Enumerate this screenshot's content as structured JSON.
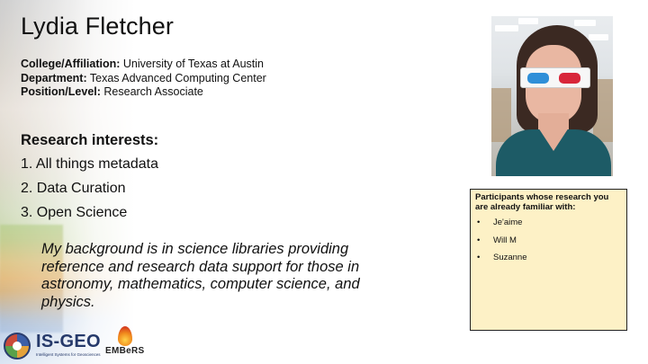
{
  "slide": {
    "name": "Lydia Fletcher",
    "affiliation": {
      "label": "College/Affiliation:",
      "value": "University of Texas at Austin"
    },
    "department": {
      "label": "Department:",
      "value": "Texas Advanced Computing Center"
    },
    "position": {
      "label": "Position/Level:",
      "value": "Research Associate"
    },
    "interests_heading": "Research interests:",
    "interests": [
      "1. All things metadata",
      "2. Data Curation",
      "3. Open Science"
    ],
    "bio": "My background is in science libraries providing reference and research data support for those in astronomy, mathematics, computer science, and physics."
  },
  "participants_box": {
    "title": "Participants whose research you are already familiar with:",
    "bullet": "•",
    "names": [
      "Je'aime",
      "Will M",
      "Suzanne"
    ],
    "background_color": "#fdf1c6"
  },
  "logos": {
    "isgeo": {
      "text": "IS-GEO",
      "subtitle": "Intelligent Systems for Geosciences"
    },
    "embers": {
      "text": "EMBeRS"
    }
  },
  "icons": [
    "isgeo-logo",
    "embers-flame-icon",
    "profile-photo"
  ]
}
